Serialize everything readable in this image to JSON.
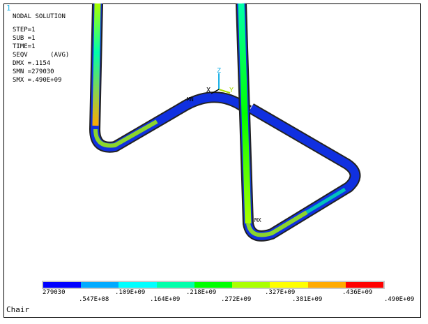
{
  "window_number": "1",
  "info": {
    "title": "NODAL SOLUTION",
    "lines": [
      "STEP=1",
      "SUB =1",
      "TIME=1",
      "SEQV      (AVG)",
      "DMX =.1154",
      "SMN =279030",
      "SMX =.490E+09"
    ]
  },
  "markers": {
    "min": "MN",
    "max": "MX"
  },
  "triad": {
    "x": "X",
    "y": "Y",
    "z": "Z"
  },
  "legend": {
    "colors": [
      "#0000ff",
      "#00aaff",
      "#00ffff",
      "#00ffaa",
      "#00ff00",
      "#aaff00",
      "#ffff00",
      "#ffaa00",
      "#ff0000"
    ],
    "labels_top": [
      "279030",
      ".109E+09",
      ".218E+09",
      ".327E+09",
      ".436E+09"
    ],
    "labels_bottom": [
      ".547E+08",
      ".164E+09",
      ".272E+09",
      ".381E+09",
      ".490E+09"
    ]
  },
  "model_title": "Chair"
}
